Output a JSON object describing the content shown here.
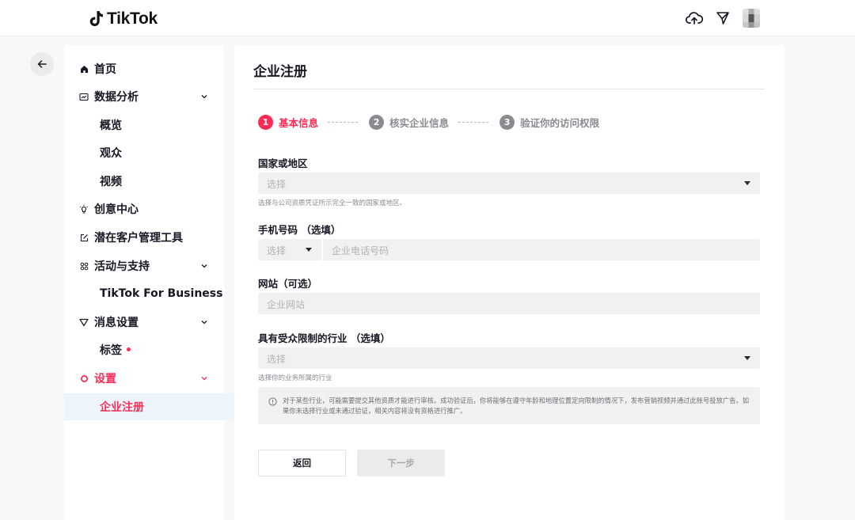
{
  "header": {
    "logo_text": "TikTok",
    "icons": [
      "upload-cloud-icon",
      "send-icon",
      "avatar"
    ]
  },
  "sidebar": {
    "items": [
      {
        "label": "首页",
        "icon": "home-icon"
      },
      {
        "label": "数据分析",
        "icon": "analytics-icon",
        "expandable": true
      },
      {
        "label": "概览"
      },
      {
        "label": "观众"
      },
      {
        "label": "视频"
      },
      {
        "label": "创意中心",
        "icon": "creative-icon"
      },
      {
        "label": "潜在客户管理工具",
        "icon": "edit-icon"
      },
      {
        "label": "活动与支持",
        "icon": "grid-icon",
        "expandable": true
      },
      {
        "label": "TikTok For Business"
      },
      {
        "label": "消息设置",
        "icon": "filter-icon",
        "expandable": true
      },
      {
        "label": "标签",
        "badge": "dot"
      },
      {
        "label": "设置",
        "icon": "gear-icon",
        "expandable": true,
        "active_parent": true
      },
      {
        "label": "企业注册",
        "active": true
      }
    ]
  },
  "main": {
    "title": "企业注册",
    "steps": [
      {
        "num": "1",
        "label": "基本信息",
        "active": true
      },
      {
        "num": "2",
        "label": "核实企业信息",
        "active": false
      },
      {
        "num": "3",
        "label": "验证你的访问权限",
        "active": false
      }
    ],
    "country": {
      "label": "国家或地区",
      "placeholder": "选择",
      "hint": "选择与公司资质凭证所示完全一致的国家或地区。"
    },
    "phone": {
      "label": "手机号码 （选填）",
      "prefix_placeholder": "选择",
      "placeholder": "企业电话号码"
    },
    "website": {
      "label": "网站（可选）",
      "placeholder": "企业网站"
    },
    "industry": {
      "label": "具有受众限制的行业 （选填）",
      "placeholder": "选择",
      "hint": "选择你的业务所属的行业"
    },
    "info_text": "对于某些行业，可能需要提交其他资质才能进行审核。成功验证后，你将能够在遵守年龄和地理位置定向限制的情况下，发布营销视频并通过此账号投放广告。如果你未选择行业或未通过验证，相关内容将没有资格进行推广。",
    "buttons": {
      "back": "返回",
      "next": "下一步"
    }
  },
  "colors": {
    "accent": "#fe2c55",
    "muted": "#8a8b91",
    "active_bg": "#eef4fb"
  }
}
